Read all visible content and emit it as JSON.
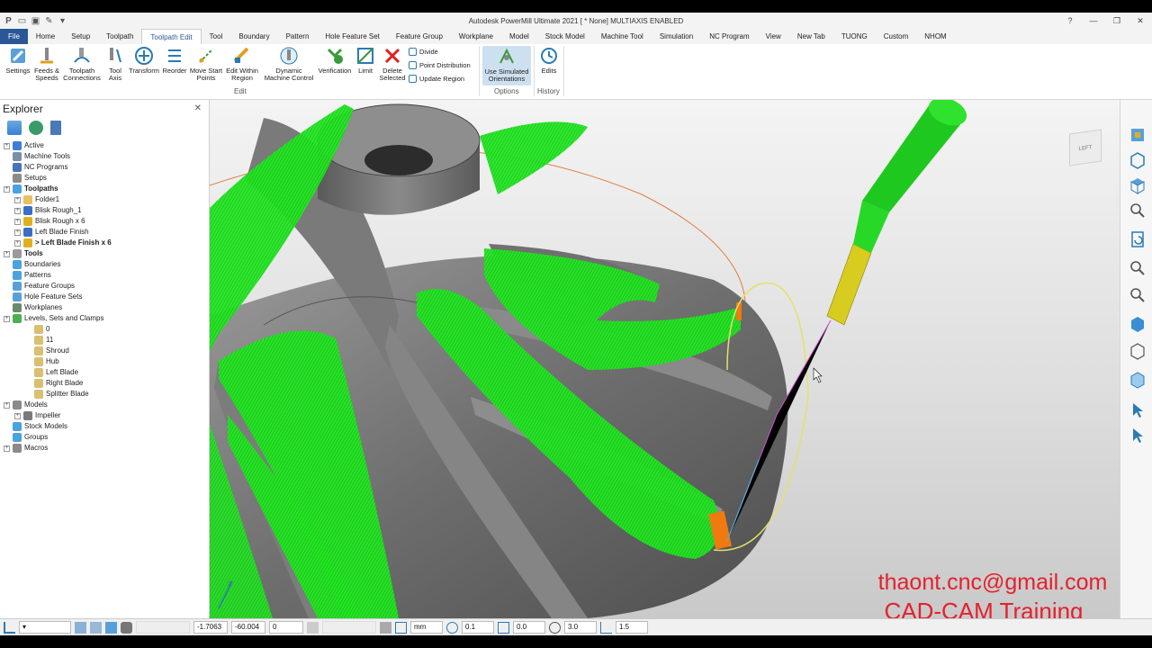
{
  "window": {
    "title": "Autodesk PowerMill Ultimate 2021   [ * None]   MULTIAXIS ENABLED"
  },
  "tabs": [
    "File",
    "Home",
    "Setup",
    "Toolpath",
    "Toolpath Edit",
    "Tool",
    "Boundary",
    "Pattern",
    "Hole Feature Set",
    "Feature Group",
    "Workplane",
    "Model",
    "Stock Model",
    "Machine Tool",
    "Simulation",
    "NC Program",
    "View",
    "New Tab",
    "TUONG",
    "Custom",
    "NHOM"
  ],
  "active_tab": "Toolpath Edit",
  "ribbon": {
    "settings": "Settings",
    "feeds": "Feeds &",
    "feeds2": "Speeds",
    "connections": "Toolpath",
    "connections2": "Connections",
    "tool_axis": "Tool",
    "tool_axis2": "Axis",
    "transform": "Transform",
    "reorder": "Reorder",
    "move_start": "Move Start",
    "move_start2": "Points",
    "edit_within": "Edit Within",
    "edit_within2": "Region",
    "dynamic": "Dynamic",
    "dynamic2": "Machine Control",
    "verification": "Verification",
    "limit": "Limit",
    "delete": "Delete",
    "delete2": "Selected",
    "divide": "Divide",
    "point_distribution": "Point Distribution",
    "update_region": "Update Region",
    "use_sim": "Use Simulated",
    "use_sim2": "Orientations",
    "edits": "Edits",
    "group_edit": "Edit",
    "group_options": "Options",
    "group_history": "History"
  },
  "explorer": {
    "title": "Explorer",
    "items": [
      {
        "label": "Active",
        "level": 0,
        "exp": true,
        "icon": "#3b7fd4"
      },
      {
        "label": "Machine Tools",
        "level": 0,
        "exp": false,
        "icon": "#7a8fa6"
      },
      {
        "label": "NC Programs",
        "level": 0,
        "exp": false,
        "icon": "#4a74b8"
      },
      {
        "label": "Setups",
        "level": 0,
        "exp": false,
        "icon": "#8a8a8a"
      },
      {
        "label": "Toolpaths",
        "level": 0,
        "exp": true,
        "bold": true,
        "icon": "#4aa3df"
      },
      {
        "label": "Folder1",
        "level": 1,
        "exp": true,
        "icon": "#e8c160"
      },
      {
        "label": "Blisk Rough_1",
        "level": 1,
        "exp": true,
        "icon": "#3a6fc4"
      },
      {
        "label": "Blisk Rough x 6",
        "level": 1,
        "exp": true,
        "icon": "#e0b020"
      },
      {
        "label": "Left Blade Finish",
        "level": 1,
        "exp": true,
        "icon": "#3a6fc4"
      },
      {
        "label": "> Left Blade Finish x 6",
        "level": 1,
        "exp": true,
        "bold": true,
        "icon": "#e0b020"
      },
      {
        "label": "Tools",
        "level": 0,
        "exp": true,
        "bold": true,
        "icon": "#9a9a9a"
      },
      {
        "label": "Boundaries",
        "level": 0,
        "exp": false,
        "icon": "#4aa3df"
      },
      {
        "label": "Patterns",
        "level": 0,
        "exp": false,
        "icon": "#4aa3df"
      },
      {
        "label": "Feature Groups",
        "level": 0,
        "exp": false,
        "icon": "#5aa0d8"
      },
      {
        "label": "Hole Feature Sets",
        "level": 0,
        "exp": false,
        "icon": "#5aa0d8"
      },
      {
        "label": "Workplanes",
        "level": 0,
        "exp": false,
        "icon": "#6a8a6a"
      },
      {
        "label": "Levels, Sets and Clamps",
        "level": 0,
        "exp": true,
        "icon": "#4caf50"
      },
      {
        "label": "0",
        "level": 2,
        "exp": false,
        "icon": "#d8c070"
      },
      {
        "label": "11",
        "level": 2,
        "exp": false,
        "icon": "#d8c070"
      },
      {
        "label": "Shroud",
        "level": 2,
        "exp": false,
        "icon": "#d8c070"
      },
      {
        "label": "Hub",
        "level": 2,
        "exp": false,
        "icon": "#d8c070"
      },
      {
        "label": "Left Blade",
        "level": 2,
        "exp": false,
        "icon": "#d8c070"
      },
      {
        "label": "Right Blade",
        "level": 2,
        "exp": false,
        "icon": "#d8c070"
      },
      {
        "label": "Splitter Blade",
        "level": 2,
        "exp": false,
        "icon": "#d8c070"
      },
      {
        "label": "Models",
        "level": 0,
        "exp": true,
        "icon": "#8a8a8a"
      },
      {
        "label": "Impeller",
        "level": 1,
        "exp": true,
        "icon": "#7a7a7a"
      },
      {
        "label": "Stock Models",
        "level": 0,
        "exp": false,
        "icon": "#4aa3df"
      },
      {
        "label": "Groups",
        "level": 0,
        "exp": false,
        "icon": "#4aa3df"
      },
      {
        "label": "Macros",
        "level": 0,
        "exp": true,
        "icon": "#8a8a8a"
      }
    ]
  },
  "viewcube_label": "LEFT",
  "watermark": {
    "email": "thaont.cnc@gmail.com",
    "training": "CAD-CAM Training"
  },
  "status": {
    "x": "-1.7063",
    "y": "-60.004",
    "z": "0",
    "units": "mm",
    "tol": "0.1",
    "thick": "0.0",
    "dia": "3.0",
    "step": "1.5"
  },
  "colors": {
    "toolpath_green": "#21e020",
    "accent_blue": "#2b5797",
    "watermark_red": "#e5202e"
  }
}
